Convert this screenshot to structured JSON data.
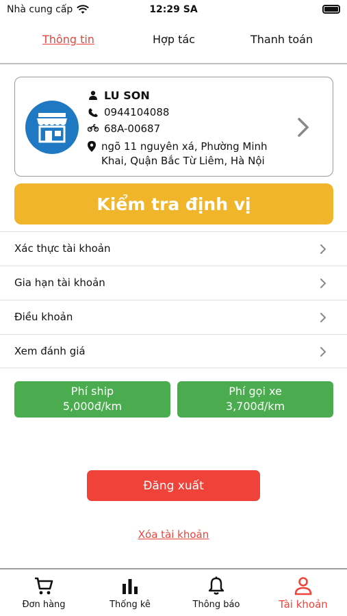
{
  "status_bar": {
    "carrier": "Nhà cung cấp",
    "time": "12:29 SA"
  },
  "tabs": [
    {
      "label": "Thông tin",
      "active": true
    },
    {
      "label": "Hợp tác",
      "active": false
    },
    {
      "label": "Thanh toán",
      "active": false
    }
  ],
  "profile": {
    "icon": "store-icon",
    "name": "LU SON",
    "phone": "0944104088",
    "plate": "68A-00687",
    "address": "ngõ 11 nguyên xá, Phường Minh Khai, Quận Bắc Từ Liêm, Hà Nội"
  },
  "locate_button": {
    "label": "Kiểm tra định vị"
  },
  "menu": [
    {
      "label": "Xác thực tài khoản"
    },
    {
      "label": "Gia hạn tài khoản"
    },
    {
      "label": "Điều khoản"
    },
    {
      "label": "Xem đánh giá"
    }
  ],
  "fees": {
    "ship": {
      "title": "Phí ship",
      "value": "5,000đ/km"
    },
    "call": {
      "title": "Phí gọi xe",
      "value": "3,700đ/km"
    }
  },
  "logout": {
    "label": "Đăng xuất"
  },
  "delete_account": {
    "label": "Xóa tài khoản"
  },
  "bottom_nav": [
    {
      "label": "Đơn hàng",
      "icon": "cart-icon",
      "active": false
    },
    {
      "label": "Thống kê",
      "icon": "bar-chart-icon",
      "active": false
    },
    {
      "label": "Thông báo",
      "icon": "bell-icon",
      "active": false
    },
    {
      "label": "Tài khoản",
      "icon": "user-icon",
      "active": true
    }
  ],
  "colors": {
    "accent_red": "#ef4238",
    "locate_yellow": "#f0b52b",
    "fee_green": "#4aac4e",
    "avatar_blue": "#1e78c2"
  }
}
